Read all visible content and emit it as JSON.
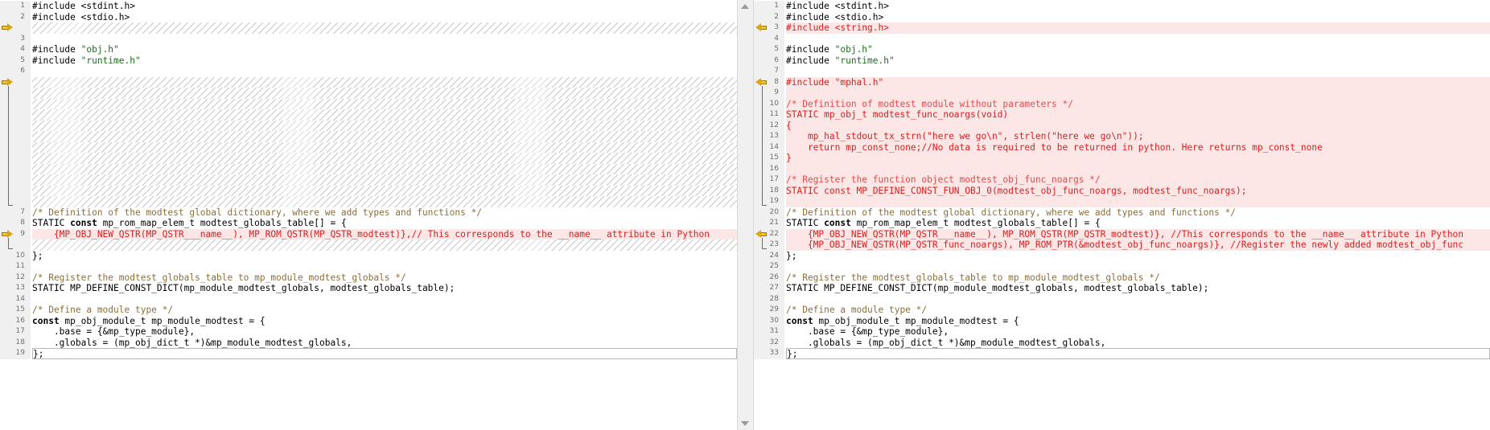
{
  "left_pane": {
    "rows": [
      {
        "n": "1",
        "type": "normal",
        "segs": [
          {
            "c": "",
            "t": "#include <stdint.h>"
          }
        ]
      },
      {
        "n": "2",
        "type": "normal",
        "segs": [
          {
            "c": "",
            "t": "#include <stdio.h>"
          }
        ]
      },
      {
        "n": "",
        "type": "hatch",
        "marker": "right",
        "segs": []
      },
      {
        "n": "3",
        "type": "normal",
        "segs": []
      },
      {
        "n": "4",
        "type": "normal",
        "segs": [
          {
            "c": "",
            "t": "#include "
          },
          {
            "c": "str",
            "t": "\"obj.h\""
          }
        ]
      },
      {
        "n": "5",
        "type": "normal",
        "segs": [
          {
            "c": "",
            "t": "#include "
          },
          {
            "c": "str",
            "t": "\"runtime.h\""
          }
        ]
      },
      {
        "n": "6",
        "type": "normal",
        "segs": []
      },
      {
        "n": "",
        "type": "hatch",
        "marker": "right",
        "segs": []
      },
      {
        "n": "",
        "type": "hatch",
        "segs": []
      },
      {
        "n": "",
        "type": "hatch",
        "segs": []
      },
      {
        "n": "",
        "type": "hatch",
        "segs": []
      },
      {
        "n": "",
        "type": "hatch",
        "segs": []
      },
      {
        "n": "",
        "type": "hatch",
        "segs": []
      },
      {
        "n": "",
        "type": "hatch",
        "segs": []
      },
      {
        "n": "",
        "type": "hatch",
        "segs": []
      },
      {
        "n": "",
        "type": "hatch",
        "segs": []
      },
      {
        "n": "",
        "type": "hatch",
        "segs": []
      },
      {
        "n": "",
        "type": "hatch",
        "segs": []
      },
      {
        "n": "",
        "type": "hatch",
        "segs": []
      },
      {
        "n": "7",
        "type": "normal",
        "segs": [
          {
            "c": "cm",
            "t": "/* Definition of the modtest global dictionary, where we add types and functions */"
          }
        ]
      },
      {
        "n": "8",
        "type": "normal",
        "segs": [
          {
            "c": "",
            "t": "STATIC "
          },
          {
            "c": "kw",
            "t": "const"
          },
          {
            "c": "",
            "t": " mp_rom_map_elem_t modtest_globals_table[] = {"
          }
        ]
      },
      {
        "n": "9",
        "type": "added",
        "marker": "right",
        "segs": [
          {
            "c": "",
            "t": "    {MP_OBJ_NEW_QSTR(MP_QSTR___name__), MP_ROM_QSTR(MP_QSTR_modtest)},// This corresponds to the __name__ attribute in Python"
          }
        ]
      },
      {
        "n": "",
        "type": "hatch",
        "segs": []
      },
      {
        "n": "10",
        "type": "normal",
        "segs": [
          {
            "c": "",
            "t": "};"
          }
        ]
      },
      {
        "n": "11",
        "type": "normal",
        "segs": []
      },
      {
        "n": "12",
        "type": "normal",
        "segs": [
          {
            "c": "cm",
            "t": "/* Register the modtest_globals_table to mp_module_modtest_globals */"
          }
        ]
      },
      {
        "n": "13",
        "type": "normal",
        "segs": [
          {
            "c": "",
            "t": "STATIC MP_DEFINE_CONST_DICT(mp_module_modtest_globals, modtest_globals_table);"
          }
        ]
      },
      {
        "n": "14",
        "type": "normal",
        "segs": []
      },
      {
        "n": "15",
        "type": "normal",
        "segs": [
          {
            "c": "cm",
            "t": "/* Define a module type */"
          }
        ]
      },
      {
        "n": "16",
        "type": "normal",
        "segs": [
          {
            "c": "kw",
            "t": "const"
          },
          {
            "c": "",
            "t": " mp_obj_module_t mp_module_modtest = {"
          }
        ]
      },
      {
        "n": "17",
        "type": "normal",
        "segs": [
          {
            "c": "",
            "t": "    .base = {&mp_type_module},"
          }
        ]
      },
      {
        "n": "18",
        "type": "normal",
        "segs": [
          {
            "c": "",
            "t": "    .globals = (mp_obj_dict_t *)&mp_module_modtest_globals,"
          }
        ]
      },
      {
        "n": "19",
        "type": "cur",
        "segs": [
          {
            "c": "",
            "t": "};"
          }
        ]
      }
    ]
  },
  "right_pane": {
    "rows": [
      {
        "n": "1",
        "type": "normal",
        "segs": [
          {
            "c": "",
            "t": "#include <stdint.h>"
          }
        ]
      },
      {
        "n": "2",
        "type": "normal",
        "segs": [
          {
            "c": "",
            "t": "#include <stdio.h>"
          }
        ]
      },
      {
        "n": "3",
        "type": "added",
        "marker": "left",
        "segs": [
          {
            "c": "",
            "t": "#include <string.h>"
          }
        ]
      },
      {
        "n": "4",
        "type": "normal",
        "segs": []
      },
      {
        "n": "5",
        "type": "normal",
        "segs": [
          {
            "c": "",
            "t": "#include "
          },
          {
            "c": "str",
            "t": "\"obj.h\""
          }
        ]
      },
      {
        "n": "6",
        "type": "normal",
        "segs": [
          {
            "c": "",
            "t": "#include "
          },
          {
            "c": "str",
            "t": "\"runtime.h\""
          }
        ]
      },
      {
        "n": "7",
        "type": "normal",
        "segs": []
      },
      {
        "n": "8",
        "type": "added",
        "marker": "left",
        "segs": [
          {
            "c": "",
            "t": "#include \"mphal.h\""
          }
        ]
      },
      {
        "n": "9",
        "type": "added",
        "segs": []
      },
      {
        "n": "10",
        "type": "added",
        "segs": [
          {
            "c": "cm",
            "t": "/* Definition of modtest module without parameters */"
          }
        ]
      },
      {
        "n": "11",
        "type": "added",
        "segs": [
          {
            "c": "",
            "t": "STATIC mp_obj_t modtest_func_noargs(void)"
          }
        ]
      },
      {
        "n": "12",
        "type": "added",
        "segs": [
          {
            "c": "",
            "t": "{"
          }
        ]
      },
      {
        "n": "13",
        "type": "added",
        "segs": [
          {
            "c": "",
            "t": "    mp_hal_stdout_tx_strn(\"here we go\\n\", strlen(\"here we go\\n\"));"
          }
        ]
      },
      {
        "n": "14",
        "type": "added",
        "segs": [
          {
            "c": "",
            "t": "    return mp_const_none;//No data is required to be returned in python. Here returns mp_const_none"
          }
        ]
      },
      {
        "n": "15",
        "type": "added",
        "segs": [
          {
            "c": "",
            "t": "}"
          }
        ]
      },
      {
        "n": "16",
        "type": "added",
        "segs": []
      },
      {
        "n": "17",
        "type": "added",
        "segs": [
          {
            "c": "cm",
            "t": "/* Register the function object modtest_obj_func_noargs */"
          }
        ]
      },
      {
        "n": "18",
        "type": "added",
        "segs": [
          {
            "c": "",
            "t": "STATIC const MP_DEFINE_CONST_FUN_OBJ_0(modtest_obj_func_noargs, modtest_func_noargs);"
          }
        ]
      },
      {
        "n": "19",
        "type": "added",
        "segs": []
      },
      {
        "n": "20",
        "type": "normal",
        "segs": [
          {
            "c": "cm",
            "t": "/* Definition of the modtest global dictionary, where we add types and functions */"
          }
        ]
      },
      {
        "n": "21",
        "type": "normal",
        "segs": [
          {
            "c": "",
            "t": "STATIC "
          },
          {
            "c": "kw",
            "t": "const"
          },
          {
            "c": "",
            "t": " mp_rom_map_elem_t modtest_globals_table[] = {"
          }
        ]
      },
      {
        "n": "22",
        "type": "added",
        "marker": "left",
        "segs": [
          {
            "c": "",
            "t": "    {MP_OBJ_NEW_QSTR(MP_QSTR___name__), MP_ROM_QSTR(MP_QSTR_modtest)}, //This corresponds to the __name__ attribute in Python"
          }
        ]
      },
      {
        "n": "23",
        "type": "added",
        "segs": [
          {
            "c": "",
            "t": "    {MP_OBJ_NEW_QSTR(MP_QSTR_func_noargs), MP_ROM_PTR(&modtest_obj_func_noargs)}, //Register the newly added modtest_obj_func"
          }
        ]
      },
      {
        "n": "24",
        "type": "normal",
        "segs": [
          {
            "c": "",
            "t": "};"
          }
        ]
      },
      {
        "n": "25",
        "type": "normal",
        "segs": []
      },
      {
        "n": "26",
        "type": "normal",
        "segs": [
          {
            "c": "cm",
            "t": "/* Register the modtest_globals_table to mp_module_modtest_globals */"
          }
        ]
      },
      {
        "n": "27",
        "type": "normal",
        "segs": [
          {
            "c": "",
            "t": "STATIC MP_DEFINE_CONST_DICT(mp_module_modtest_globals, modtest_globals_table);"
          }
        ]
      },
      {
        "n": "28",
        "type": "normal",
        "segs": []
      },
      {
        "n": "29",
        "type": "normal",
        "segs": [
          {
            "c": "cm",
            "t": "/* Define a module type */"
          }
        ]
      },
      {
        "n": "30",
        "type": "normal",
        "segs": [
          {
            "c": "kw",
            "t": "const"
          },
          {
            "c": "",
            "t": " mp_obj_module_t mp_module_modtest = {"
          }
        ]
      },
      {
        "n": "31",
        "type": "normal",
        "segs": [
          {
            "c": "",
            "t": "    .base = {&mp_type_module},"
          }
        ]
      },
      {
        "n": "32",
        "type": "normal",
        "segs": [
          {
            "c": "",
            "t": "    .globals = (mp_obj_dict_t *)&mp_module_modtest_globals,"
          }
        ]
      },
      {
        "n": "33",
        "type": "cur",
        "segs": [
          {
            "c": "",
            "t": "};"
          }
        ]
      }
    ]
  }
}
